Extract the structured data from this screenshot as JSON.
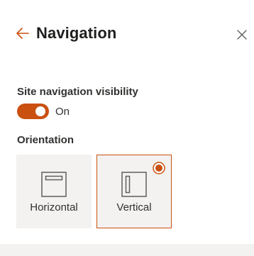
{
  "header": {
    "title": "Navigation",
    "back_icon": "arrow-left-icon",
    "close_icon": "close-icon"
  },
  "visibility": {
    "label": "Site navigation visibility",
    "toggle_state": "On",
    "toggle_on": true
  },
  "orientation": {
    "label": "Orientation",
    "options": [
      {
        "label": "Horizontal",
        "icon": "horizontal-layout-icon",
        "selected": false
      },
      {
        "label": "Vertical",
        "icon": "vertical-layout-icon",
        "selected": true
      }
    ]
  },
  "colors": {
    "accent": "#ca5010",
    "panel": "#ffffff",
    "option_bg": "#f3f2f1",
    "text": "#323130"
  }
}
